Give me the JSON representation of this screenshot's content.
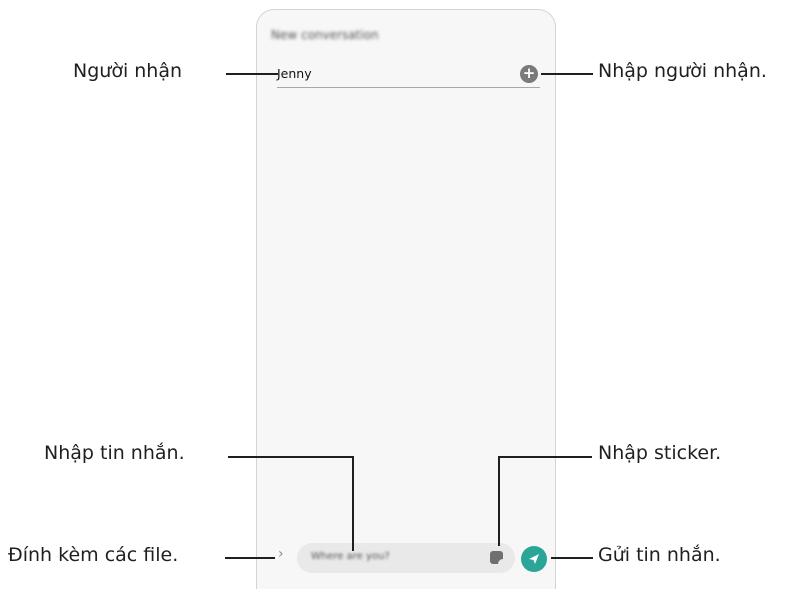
{
  "screen": {
    "title": "New conversation",
    "recipient": "Jenny",
    "message_placeholder": "Where are you?"
  },
  "callouts": {
    "recipient": "Người nhận",
    "enter_recipient": "Nhập người nhận.",
    "enter_message": "Nhập tin nhắn.",
    "enter_sticker": "Nhập sticker.",
    "attach_files": "Đính kèm các file.",
    "send_message": "Gửi tin nhắn."
  },
  "icons": [
    "add-recipient-icon",
    "attach-arrow-icon",
    "sticker-icon",
    "send-icon"
  ],
  "colors": {
    "send_button": "#2ba597",
    "add_button": "#7a7a7a"
  }
}
